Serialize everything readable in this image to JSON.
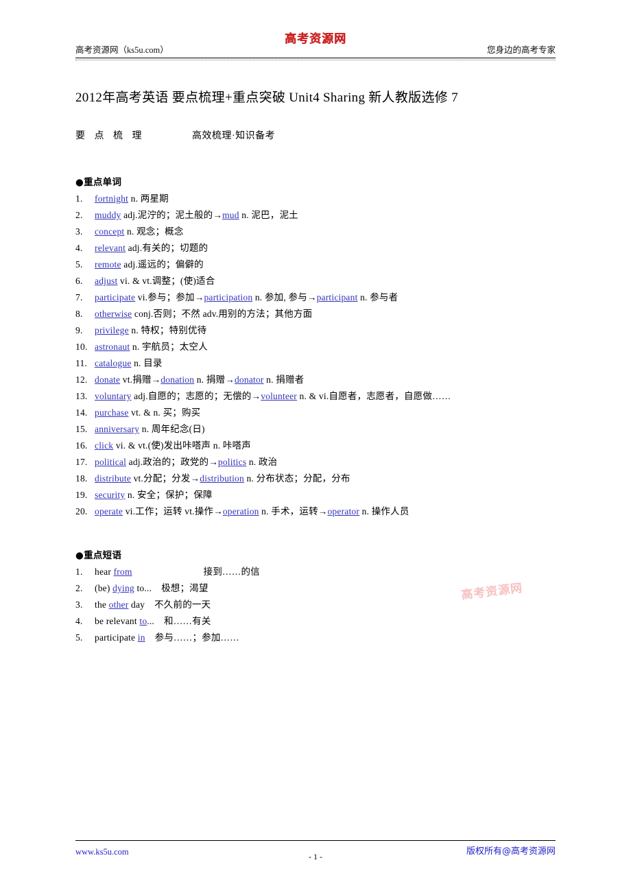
{
  "header": {
    "logo": "高考资源网",
    "left": "高考资源网（ks5u.com）",
    "right": "您身边的高考专家"
  },
  "title": "2012年高考英语 要点梳理+重点突破 Unit4  Sharing 新人教版选修 7",
  "banner": {
    "title": "要 点 梳 理",
    "subtitle": "高效梳理·知识备考"
  },
  "words_section": {
    "heading": "●重点单词",
    "items": [
      {
        "num": "1.",
        "pre": "",
        "word": "fortnight",
        "post": " n. 两星期"
      },
      {
        "num": "2.",
        "pre": "",
        "word": "muddy",
        "post": " adj.泥泞的；泥土般的→",
        "word2": "mud",
        "post2": " n. 泥巴，泥土"
      },
      {
        "num": "3.",
        "pre": "",
        "word": "concept",
        "post": " n. 观念；概念"
      },
      {
        "num": "4.",
        "pre": "",
        "word": "relevant",
        "post": " adj.有关的；切题的"
      },
      {
        "num": "5.",
        "pre": "",
        "word": "remote",
        "post": " adj.遥远的；偏僻的"
      },
      {
        "num": "6.",
        "pre": "",
        "word": "adjust",
        "post": " vi. & vt.调整；(使)适合"
      },
      {
        "num": "7.",
        "pre": "",
        "word": "participate",
        "post": " vi.参与；参加→",
        "word2": "participation",
        "post2": " n. 参加, 参与→",
        "word3": "participant",
        "post3": " n. 参与者"
      },
      {
        "num": "8.",
        "pre": "",
        "word": "otherwise",
        "post": " conj.否则；不然 adv.用别的方法；其他方面"
      },
      {
        "num": "9.",
        "pre": "",
        "word": "privilege",
        "post": " n. 特权；特别优待"
      },
      {
        "num": "10.",
        "pre": "",
        "word": "astronaut",
        "post": " n. 宇航员；太空人"
      },
      {
        "num": "11.",
        "pre": "",
        "word": "catalogue",
        "post": " n. 目录"
      },
      {
        "num": "12.",
        "pre": "",
        "word": "donate",
        "post": " vt.捐赠→",
        "word2": "donation",
        "post2": " n. 捐赠→",
        "word3": "donator",
        "post3": " n. 捐赠者"
      },
      {
        "num": "13.",
        "pre": "",
        "word": "voluntary",
        "post": " adj.自愿的；志愿的；无偿的→",
        "word2": "volunteer",
        "post2": " n. & vi.自愿者，志愿者，自愿做……"
      },
      {
        "num": "14.",
        "pre": "",
        "word": "purchase",
        "post": " vt. & n. 买；购买"
      },
      {
        "num": "15.",
        "pre": "",
        "word": "anniversary",
        "post": " n. 周年纪念(日)"
      },
      {
        "num": "16.",
        "pre": "",
        "word": "click",
        "post": " vi. & vt.(使)发出咔嗒声 n. 咔嗒声"
      },
      {
        "num": "17.",
        "pre": "",
        "word": "political",
        "post": " adj.政治的；政党的→",
        "word2": "politics",
        "post2": " n. 政治"
      },
      {
        "num": "18.",
        "pre": "",
        "word": "distribute",
        "post": " vt.分配；分发→",
        "word2": "distribution",
        "post2": " n. 分布状态；分配，分布"
      },
      {
        "num": "19.",
        "pre": "",
        "word": "security",
        "post": " n. 安全；保护；保障"
      },
      {
        "num": "20.",
        "pre": "",
        "word": "operate",
        "post": " vi.工作；运转 vt.操作→",
        "word2": "operation",
        "post2": " n. 手术，运转→",
        "word3": "operator",
        "post3": " n. 操作人员"
      }
    ]
  },
  "phrases_section": {
    "heading": "●重点短语",
    "items": [
      {
        "num": "1.",
        "pre": "hear ",
        "word": "from",
        "post": "",
        "meaning": "接到……的信"
      },
      {
        "num": "2.",
        "pre": "(be) ",
        "word": "dying",
        "post": " to...",
        "meaning": "极想；渴望"
      },
      {
        "num": "3.",
        "pre": "the ",
        "word": "other",
        "post": " day",
        "meaning": "不久前的一天"
      },
      {
        "num": "4.",
        "pre": "be relevant ",
        "word": "to",
        "post": "...",
        "meaning": "和……有关"
      },
      {
        "num": "5.",
        "pre": "participate ",
        "word": "in",
        "post": "",
        "meaning": "参与……；参加……"
      }
    ]
  },
  "watermark": "高考资源网",
  "footer": {
    "left": "www.ks5u.com",
    "center": "- 1 -",
    "right": "版权所有@高考资源网"
  },
  "colors": {
    "link": "#3333bb",
    "logo_red": "#cc2222",
    "footer_blue": "#2222cc",
    "watermark_pink": "#f7b6b6"
  }
}
